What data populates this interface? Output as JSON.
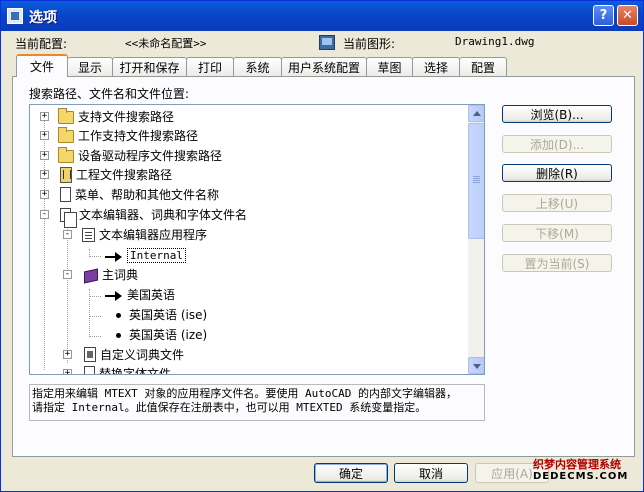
{
  "window": {
    "title": "选项",
    "help_glyph": "?",
    "close_glyph": "✕"
  },
  "profile": {
    "current_profile_label": "当前配置:",
    "current_profile_value": "<<未命名配置>>",
    "current_drawing_label": "当前图形:",
    "current_drawing_value": "Drawing1.dwg"
  },
  "tabs": [
    {
      "label": "文件",
      "active": true
    },
    {
      "label": "显示"
    },
    {
      "label": "打开和保存"
    },
    {
      "label": "打印"
    },
    {
      "label": "系统"
    },
    {
      "label": "用户系统配置"
    },
    {
      "label": "草图"
    },
    {
      "label": "选择"
    },
    {
      "label": "配置"
    }
  ],
  "tree_label": "搜索路径、文件名和文件位置:",
  "tree": [
    {
      "label": "支持文件搜索路径",
      "icon": "folder-icon",
      "expander": "+"
    },
    {
      "label": "工作支持文件搜索路径",
      "icon": "folder-icon",
      "expander": "+"
    },
    {
      "label": "设备驱动程序文件搜索路径",
      "icon": "folder-icon",
      "expander": "+"
    },
    {
      "label": "工程文件搜索路径",
      "icon": "project-icon",
      "expander": "+"
    },
    {
      "label": "菜单、帮助和其他文件名称",
      "icon": "document-icon",
      "expander": "+"
    },
    {
      "label": "文本编辑器、词典和字体文件名",
      "icon": "documents-icon",
      "expander": "-"
    },
    {
      "label": "文本编辑器应用程序",
      "icon": "text-editor-icon",
      "expander": "-"
    },
    {
      "label": "Internal",
      "icon": "arrow-icon",
      "selected": true
    },
    {
      "label": "主词典",
      "icon": "book-icon",
      "expander": "-"
    },
    {
      "label": "美国英语",
      "icon": "arrow-icon"
    },
    {
      "label": "英国英语 (ise)",
      "icon": "bullet-icon"
    },
    {
      "label": "英国英语 (ize)",
      "icon": "bullet-icon"
    },
    {
      "label": "自定义词典文件",
      "icon": "dictionary-icon",
      "expander": "+"
    },
    {
      "label": "替换字体文件",
      "icon": "document-icon",
      "expander": "+"
    }
  ],
  "description": {
    "line1": "指定用来编辑 MTEXT 对象的应用程序文件名。要使用 AutoCAD 的内部文字编辑器，",
    "line2": "请指定 Internal。此值保存在注册表中，也可以用 MTEXTED 系统变量指定。"
  },
  "side_buttons": {
    "browse": "浏览(B)...",
    "add": "添加(D)...",
    "remove": "删除(R)",
    "move_up": "上移(U)",
    "move_down": "下移(M)",
    "set_current": "置为当前(S)"
  },
  "bottom_buttons": {
    "ok": "确定",
    "cancel": "取消",
    "apply": "应用(A)"
  },
  "watermark": {
    "line1": "织梦内容管理系统",
    "line2": "DEDECMS.COM"
  }
}
